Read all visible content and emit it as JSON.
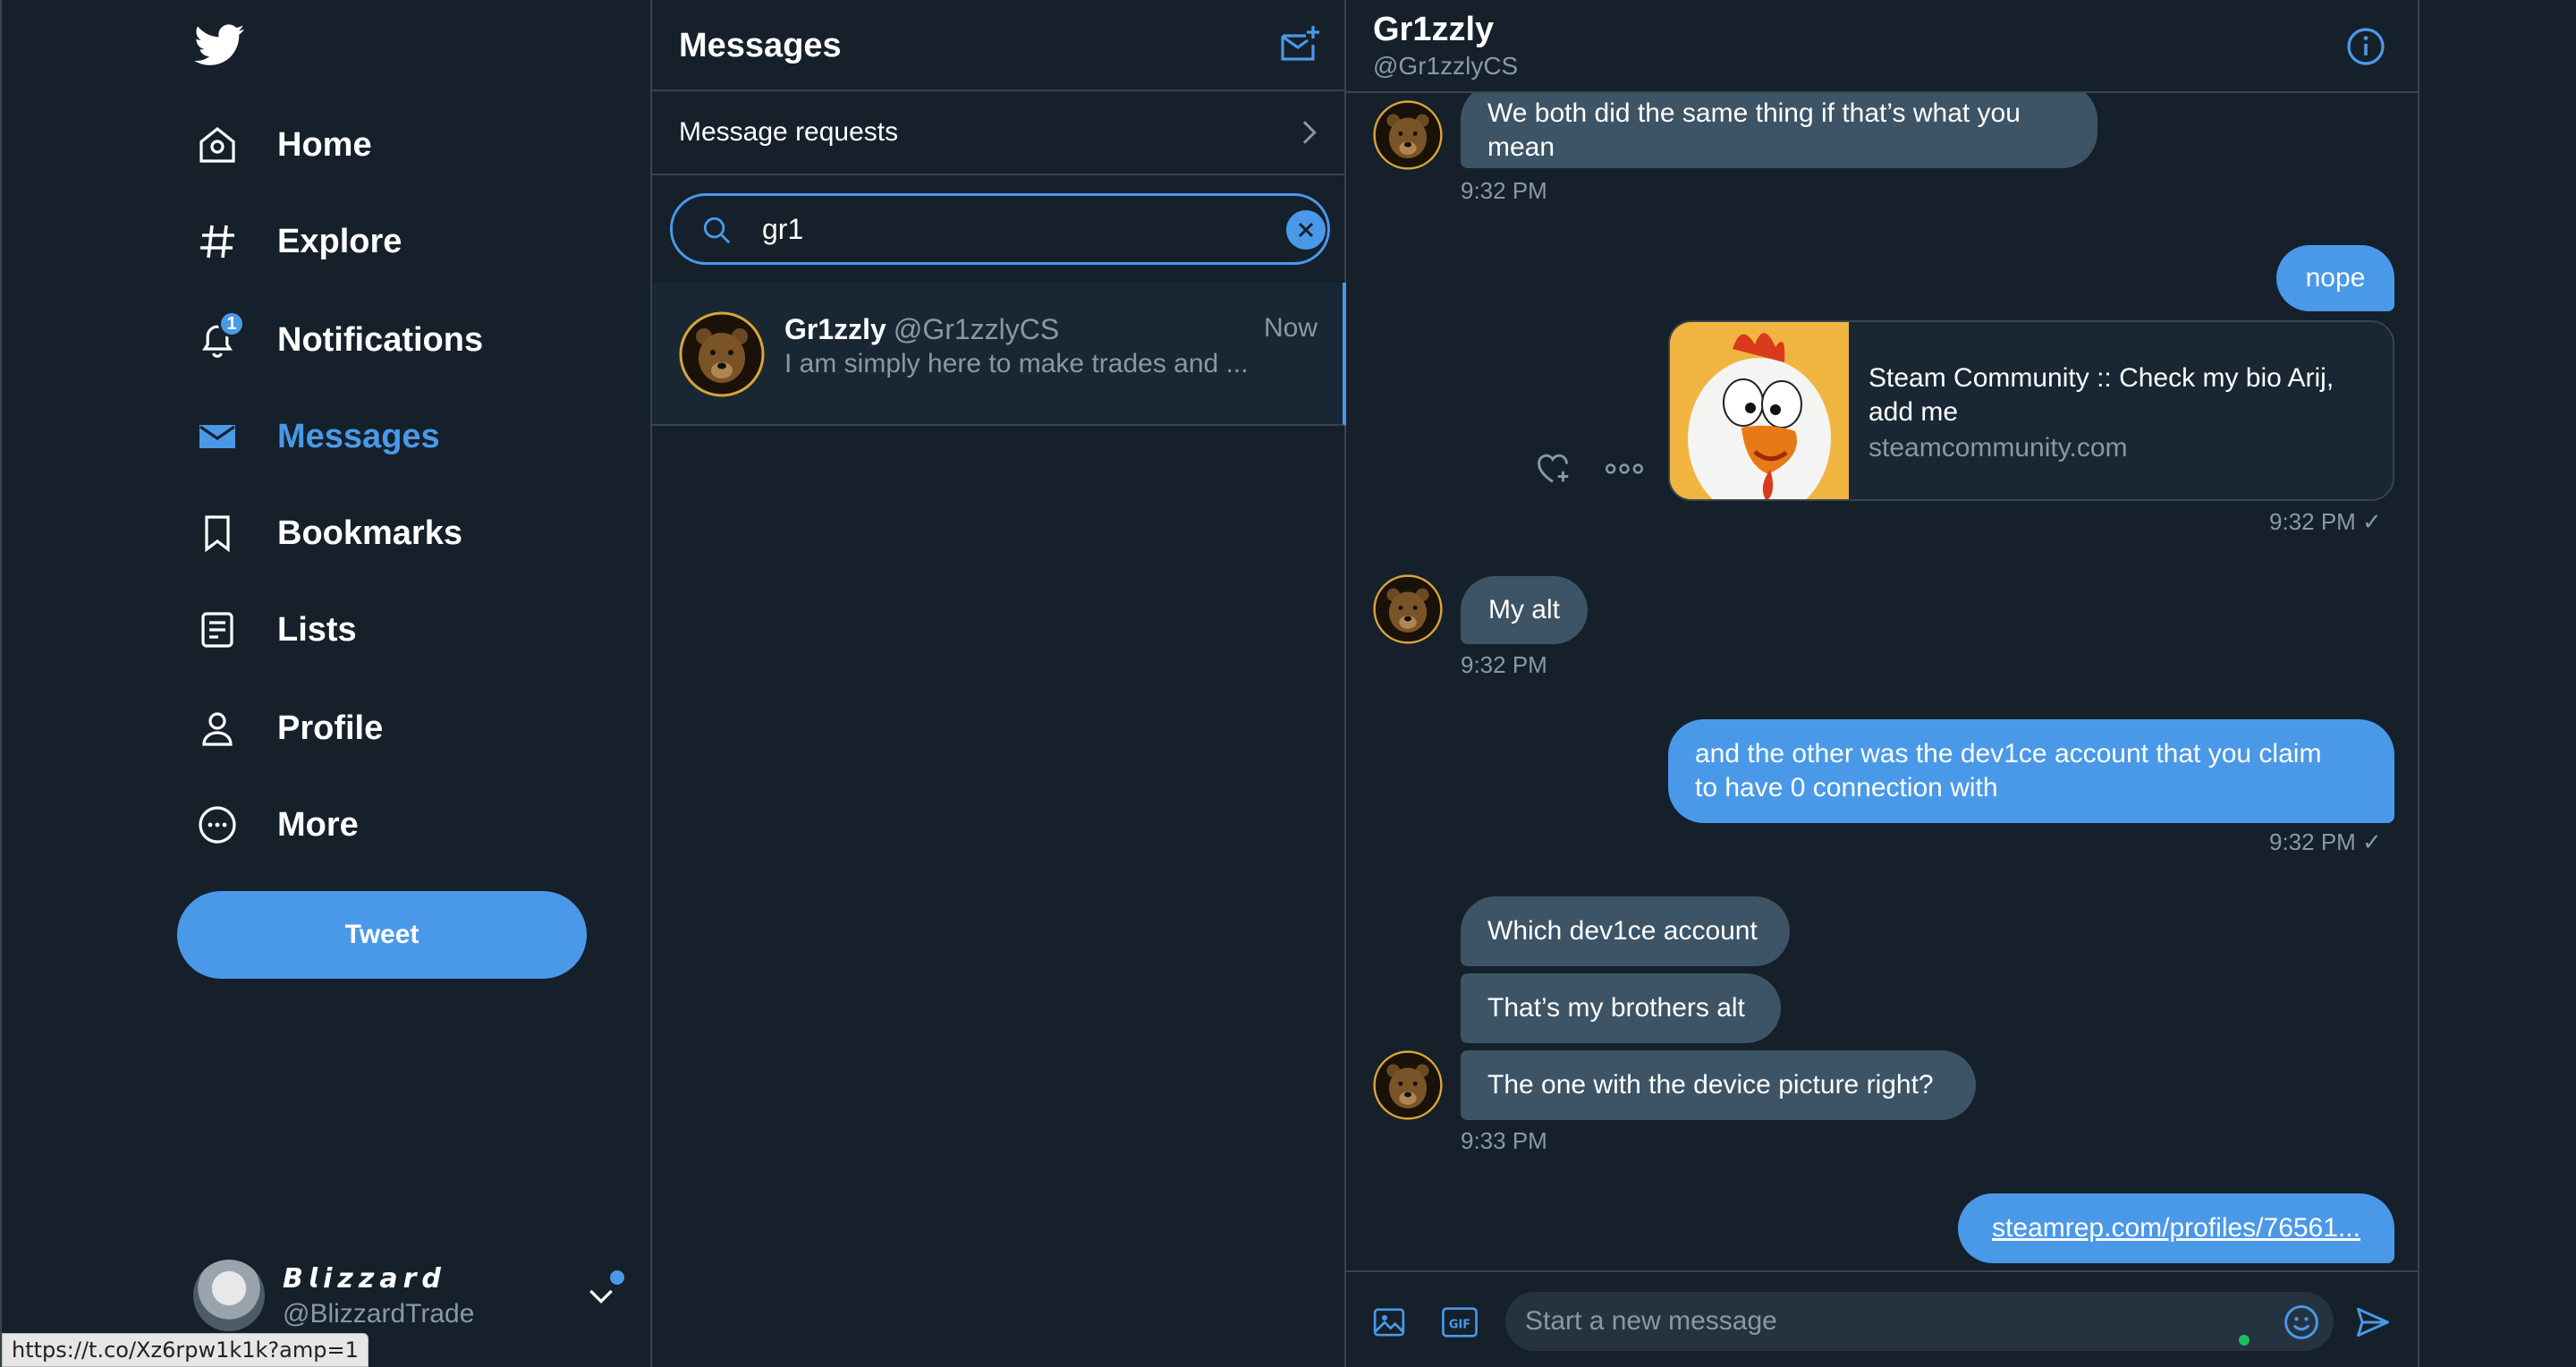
{
  "nav": {
    "items": [
      {
        "label": "Home",
        "icon": "home-icon"
      },
      {
        "label": "Explore",
        "icon": "hashtag-icon"
      },
      {
        "label": "Notifications",
        "icon": "bell-icon",
        "badge": "1"
      },
      {
        "label": "Messages",
        "icon": "mail-icon",
        "active": true
      },
      {
        "label": "Bookmarks",
        "icon": "bookmark-icon"
      },
      {
        "label": "Lists",
        "icon": "list-icon"
      },
      {
        "label": "Profile",
        "icon": "person-icon"
      },
      {
        "label": "More",
        "icon": "more-circle-icon"
      }
    ],
    "tweet_label": "Tweet",
    "account": {
      "name": "𝘽𝙡𝙞𝙯𝙯𝙖𝙧𝙙",
      "handle": "@BlizzardTrade"
    },
    "status_url": "https://t.co/Xz6rpw1k1k?amp=1"
  },
  "messages": {
    "title": "Messages",
    "requests_label": "Message requests",
    "search_value": "gr1",
    "conversation": {
      "name": "Gr1zzly",
      "handle": "@Gr1zzlyCS",
      "time": "Now",
      "preview": "I am simply here to make trades and ..."
    }
  },
  "chat": {
    "name": "Gr1zzly",
    "handle": "@Gr1zzlyCS",
    "msg1_line1": "We both did the same thing if that’s what you",
    "msg1_line2": "mean",
    "msg1_time": "9:32 PM",
    "msg2": "nope",
    "card_title_line1": "Steam Community :: Check my bio Arij,",
    "card_title_line2": "add me",
    "card_domain": "steamcommunity.com",
    "card_time": "9:32 PM ✓",
    "msg3": "My alt",
    "msg3_time": "9:32 PM",
    "msg4_line1": "and the other was the dev1ce account that you claim",
    "msg4_line2": "to have 0 connection with",
    "msg4_time": "9:32 PM ✓",
    "msg5": "Which dev1ce account",
    "msg6": "That’s my brothers alt",
    "msg7": "The one with the device picture right?",
    "msg7_time": "9:33 PM",
    "msg8": "steamrep.com/profiles/76561...",
    "composer_placeholder": "Start a new message"
  },
  "colors": {
    "background": "#15202b",
    "accent": "#4a99e9",
    "incoming_bubble": "#3d5466",
    "border": "#38444d",
    "muted_text": "#8899a6"
  }
}
